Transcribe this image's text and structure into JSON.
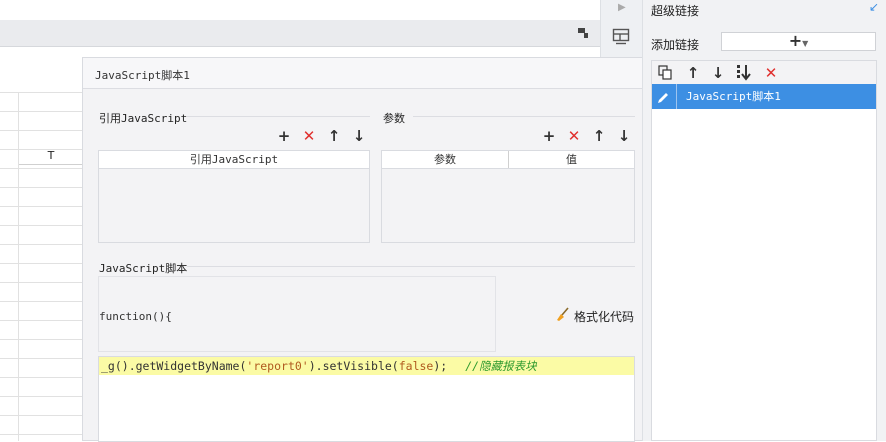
{
  "sheet": {
    "column_header": "T"
  },
  "dialog": {
    "title": "JavaScript脚本1",
    "ref_section_label": "引用JavaScript",
    "ref_table_header": "引用JavaScript",
    "param_section_label": "参数",
    "param_headers": [
      "参数",
      "值"
    ],
    "script_section_label": "JavaScript脚本",
    "function_open": "function(){",
    "format_button": "格式化代码",
    "code": {
      "prefix": "_g().getWidgetByName(",
      "string": "'report0'",
      "middle": ").setVisible(",
      "keyword": "false",
      "suffix": ");",
      "comment": "//隐藏报表块"
    }
  },
  "right_panel": {
    "title": "超级链接",
    "add_label": "添加链接",
    "items": [
      {
        "label": "JavaScript脚本1",
        "selected": true
      }
    ]
  },
  "colors": {
    "selection": "#3d8fe3",
    "delete_red": "#e0302e",
    "code_highlight": "#fbfba5",
    "comment_green": "#2e9a2e",
    "string_brown": "#b05a1e"
  }
}
